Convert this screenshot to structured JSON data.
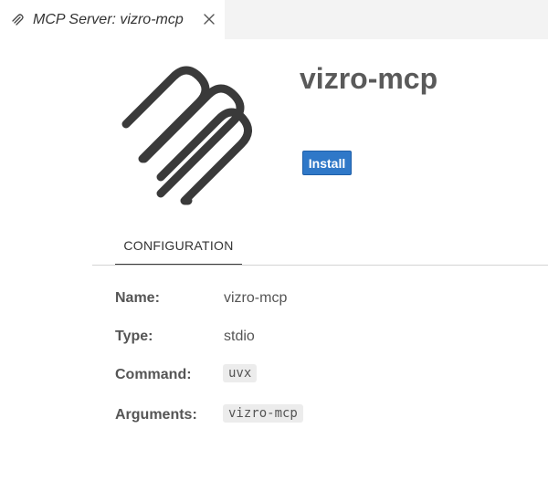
{
  "tab": {
    "title": "MCP Server: vizro-mcp",
    "icon": "mcp-icon",
    "close_icon": "close-icon"
  },
  "server": {
    "name": "vizro-mcp",
    "logo": "vizro-logo"
  },
  "actions": {
    "install_label": "Install"
  },
  "sections": {
    "configuration_label": "CONFIGURATION"
  },
  "configuration": {
    "rows": [
      {
        "label": "Name:",
        "value": "vizro-mcp"
      },
      {
        "label": "Type:",
        "value": "stdio"
      },
      {
        "label": "Command:",
        "value": "uvx"
      },
      {
        "label": "Arguments:",
        "value": "vizro-mcp"
      }
    ]
  },
  "colors": {
    "accent": "#2f78c8",
    "logo": "#3a3a3a",
    "chip_bg": "#ececec"
  }
}
